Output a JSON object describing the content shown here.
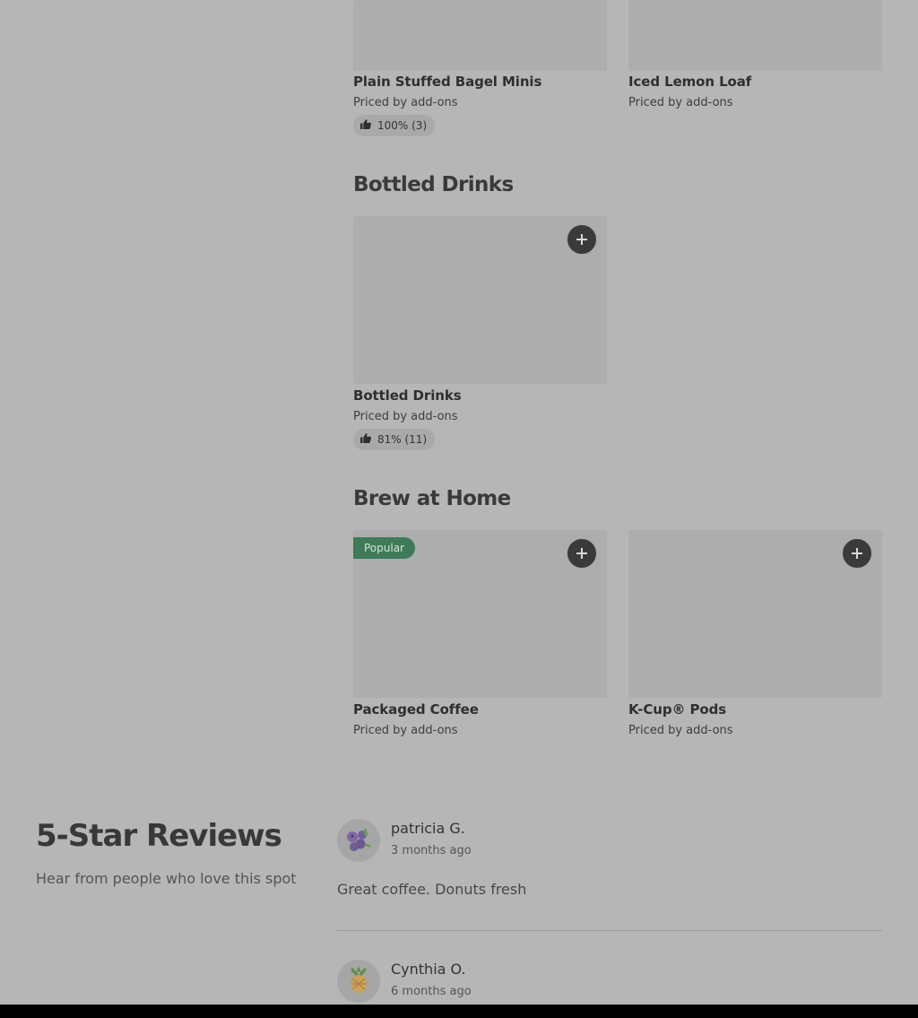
{
  "sections": {
    "top": {
      "items": [
        {
          "name": "Plain Stuffed Bagel Minis",
          "price": "Priced by add-ons",
          "rating": "100% (3)"
        },
        {
          "name": "Iced Lemon Loaf",
          "price": "Priced by add-ons"
        }
      ]
    },
    "bottled": {
      "title": "Bottled Drinks",
      "items": [
        {
          "name": "Bottled Drinks",
          "price": "Priced by add-ons",
          "rating": "81% (11)"
        }
      ]
    },
    "brew": {
      "title": "Brew at Home",
      "items": [
        {
          "name": "Packaged Coffee",
          "price": "Priced by add-ons",
          "badge": "Popular"
        },
        {
          "name": "K-Cup® Pods",
          "price": "Priced by add-ons"
        }
      ]
    }
  },
  "reviews": {
    "title": "5-Star Reviews",
    "subtitle": "Hear from people who love this spot",
    "entries": [
      {
        "name": "patricia G.",
        "date": "3 months ago",
        "text": "Great coffee. Donuts fresh",
        "avatar_icon": "blueberry-icon"
      },
      {
        "name": "Cynthia O.",
        "date": "6 months ago",
        "avatar_icon": "pineapple-icon"
      }
    ]
  },
  "colors": {
    "overlay_background": "#b6b6b6",
    "popular_badge": "#3f7b58",
    "add_button": "#3a3a3a"
  }
}
